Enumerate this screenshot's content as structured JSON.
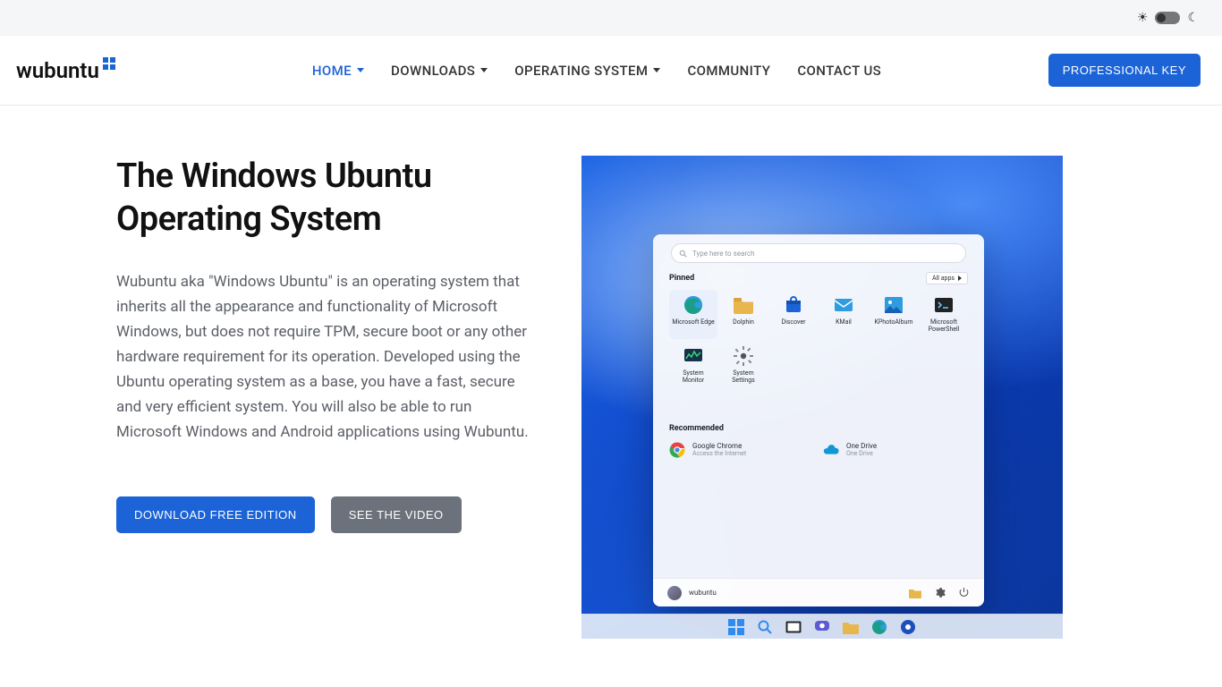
{
  "theme_bar": {
    "sun_glyph": "☀",
    "moon_glyph": "☾"
  },
  "brand": {
    "name": "wubuntu"
  },
  "nav": {
    "items": [
      {
        "label": "HOME",
        "active": true,
        "dropdown": true
      },
      {
        "label": "DOWNLOADS",
        "active": false,
        "dropdown": true
      },
      {
        "label": "OPERATING SYSTEM",
        "active": false,
        "dropdown": true
      },
      {
        "label": "COMMUNITY",
        "active": false,
        "dropdown": false
      },
      {
        "label": "CONTACT US",
        "active": false,
        "dropdown": false
      }
    ],
    "cta": "PROFESSIONAL KEY"
  },
  "hero": {
    "title": "The Windows Ubuntu Operating System",
    "description": "Wubuntu aka \"Windows Ubuntu\" is an operating system that inherits all the appearance and functionality of Microsoft Windows, but does not require TPM, secure boot or any other hardware requirement for its operation. Developed using the Ubuntu operating system as a base, you have a fast, secure and very efficient system. You will also be able to run Microsoft Windows and Android applications using Wubuntu.",
    "primary_button": "DOWNLOAD FREE EDITION",
    "secondary_button": "SEE THE VIDEO"
  },
  "start_menu": {
    "search_placeholder": "Type here to search",
    "pinned_label": "Pinned",
    "all_apps_label": "All apps",
    "pinned": [
      {
        "label": "Microsoft Edge",
        "icon": "edge",
        "selected": true
      },
      {
        "label": "Dolphin",
        "icon": "folder"
      },
      {
        "label": "Discover",
        "icon": "bag"
      },
      {
        "label": "KMail",
        "icon": "mail"
      },
      {
        "label": "KPhotoAlbum",
        "icon": "photo"
      },
      {
        "label": "Microsoft PowerShell",
        "icon": "terminal"
      },
      {
        "label": "System Monitor",
        "icon": "monitor"
      },
      {
        "label": "System Settings",
        "icon": "gear"
      }
    ],
    "recommended_label": "Recommended",
    "recommended": [
      {
        "title": "Google Chrome",
        "sub": "Access the Internet",
        "icon": "chrome"
      },
      {
        "title": "One Drive",
        "sub": "One Drive",
        "icon": "onedrive"
      }
    ],
    "user_name": "wubuntu"
  },
  "taskbar": {
    "items": [
      "start",
      "search",
      "taskview",
      "chat",
      "files",
      "edge",
      "logo"
    ]
  }
}
